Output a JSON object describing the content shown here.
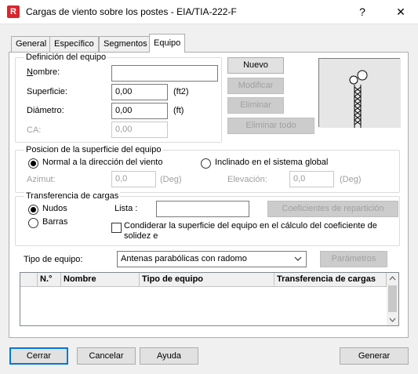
{
  "window": {
    "title": "Cargas de viento sobre los postes - EIA/TIA-222-F",
    "app_icon_letter": "R",
    "help_label": "?",
    "close_label": "✕"
  },
  "tabs": [
    {
      "label": "General"
    },
    {
      "label": "Específico"
    },
    {
      "label": "Segmentos"
    },
    {
      "label": "Equipo",
      "active": true
    }
  ],
  "equipment_definition": {
    "legend": "Definición del equipo",
    "name_label": "Nombre:",
    "name_value": "",
    "surface_label": "Superficie:",
    "surface_value": "0,00",
    "surface_unit": "(ft2)",
    "diameter_label": "Diámetro:",
    "diameter_value": "0,00",
    "diameter_unit": "(ft)",
    "ca_label": "CA:",
    "ca_value": "0,00"
  },
  "actions": {
    "new": "Nuevo",
    "modify": "Modificar",
    "delete": "Eliminar",
    "delete_all": "Eliminar todo"
  },
  "surface_position": {
    "legend": "Posicion de la superficie del equipo",
    "option_normal": "Normal a la dirección del viento",
    "option_inclined": "Inclinado en el sistema global",
    "azimuth_label": "Azimut:",
    "azimuth_value": "0,0",
    "azimuth_unit": "(Deg)",
    "elevation_label": "Elevación:",
    "elevation_value": "0,0",
    "elevation_unit": "(Deg)"
  },
  "load_transfer": {
    "legend": "Transferencia de cargas",
    "option_nodes": "Nudos",
    "option_bars": "Barras",
    "list_label": "Lista :",
    "list_value": "",
    "coefficients_button": "Coeficientes de repartición",
    "consider_checkbox_line1": "Condiderar la superficie del equipo en el cálculo del coeficiente de",
    "consider_checkbox_line2": "solidez e"
  },
  "equipment_type": {
    "label": "Tipo de equipo:",
    "selected": "Antenas parabólicas con radomo",
    "params_button": "Parámetros"
  },
  "table": {
    "columns": [
      "N.°",
      "Nombre",
      "Tipo de equipo",
      "Transferencia de cargas"
    ],
    "rows": []
  },
  "footer": {
    "close": "Cerrar",
    "cancel": "Cancelar",
    "help": "Ayuda",
    "generate": "Generar"
  }
}
